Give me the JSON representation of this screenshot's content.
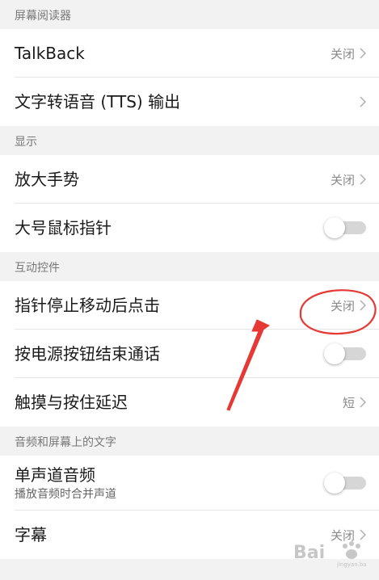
{
  "sections": [
    {
      "header": "屏幕阅读器",
      "rows": [
        {
          "title": "TalkBack",
          "value": "关闭"
        },
        {
          "title": "文字转语音 (TTS) 输出"
        }
      ]
    },
    {
      "header": "显示",
      "rows": [
        {
          "title": "放大手势",
          "value": "关闭"
        },
        {
          "title": "大号鼠标指针",
          "toggle": false
        }
      ]
    },
    {
      "header": "互动控件",
      "rows": [
        {
          "title": "指针停止移动后点击",
          "value": "关闭"
        },
        {
          "title": "按电源按钮结束通话",
          "toggle": false
        },
        {
          "title": "触摸与按住延迟",
          "value": "短"
        }
      ]
    },
    {
      "header": "音频和屏幕上的文字",
      "rows": [
        {
          "title": "单声道音频",
          "subtitle": "播放音频时合并声道",
          "toggle": false
        },
        {
          "title": "字幕",
          "value": "关闭"
        }
      ]
    }
  ],
  "annotation": {
    "color": "#e53935"
  },
  "watermark": {
    "text": "Bai"
  }
}
